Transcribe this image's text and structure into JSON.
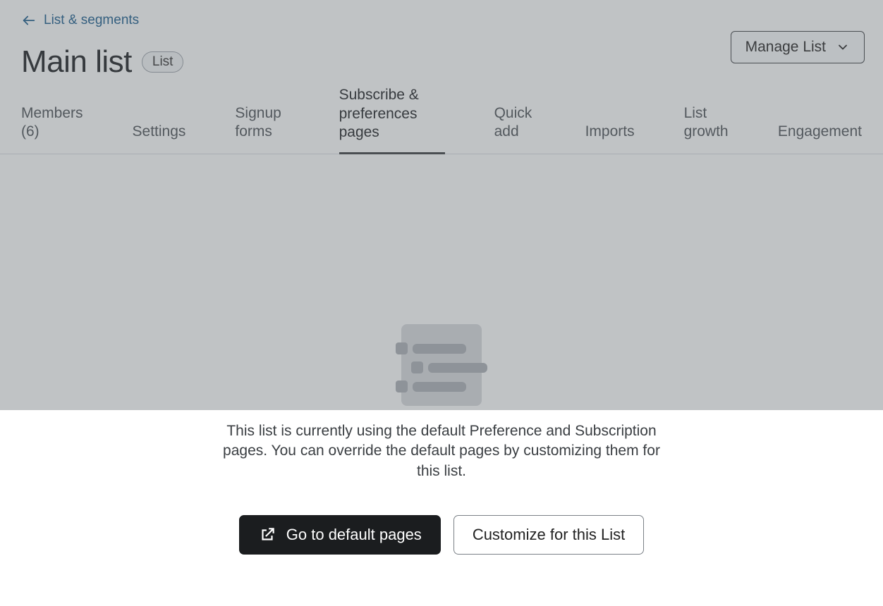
{
  "breadcrumb": {
    "label": "List & segments"
  },
  "header": {
    "title": "Main list",
    "badge": "List",
    "manage_label": "Manage List"
  },
  "tabs": [
    {
      "label": "Members (6)"
    },
    {
      "label": "Settings"
    },
    {
      "label": "Signup forms"
    },
    {
      "label": "Subscribe & preferences pages"
    },
    {
      "label": "Quick add"
    },
    {
      "label": "Imports"
    },
    {
      "label": "List growth"
    },
    {
      "label": "Engagement"
    }
  ],
  "empty_state": {
    "description": "This list is currently using the default Preference and Subscription pages. You can override the default pages by customizing them for this list.",
    "primary_btn": "Go to default pages",
    "secondary_btn": "Customize for this List"
  }
}
